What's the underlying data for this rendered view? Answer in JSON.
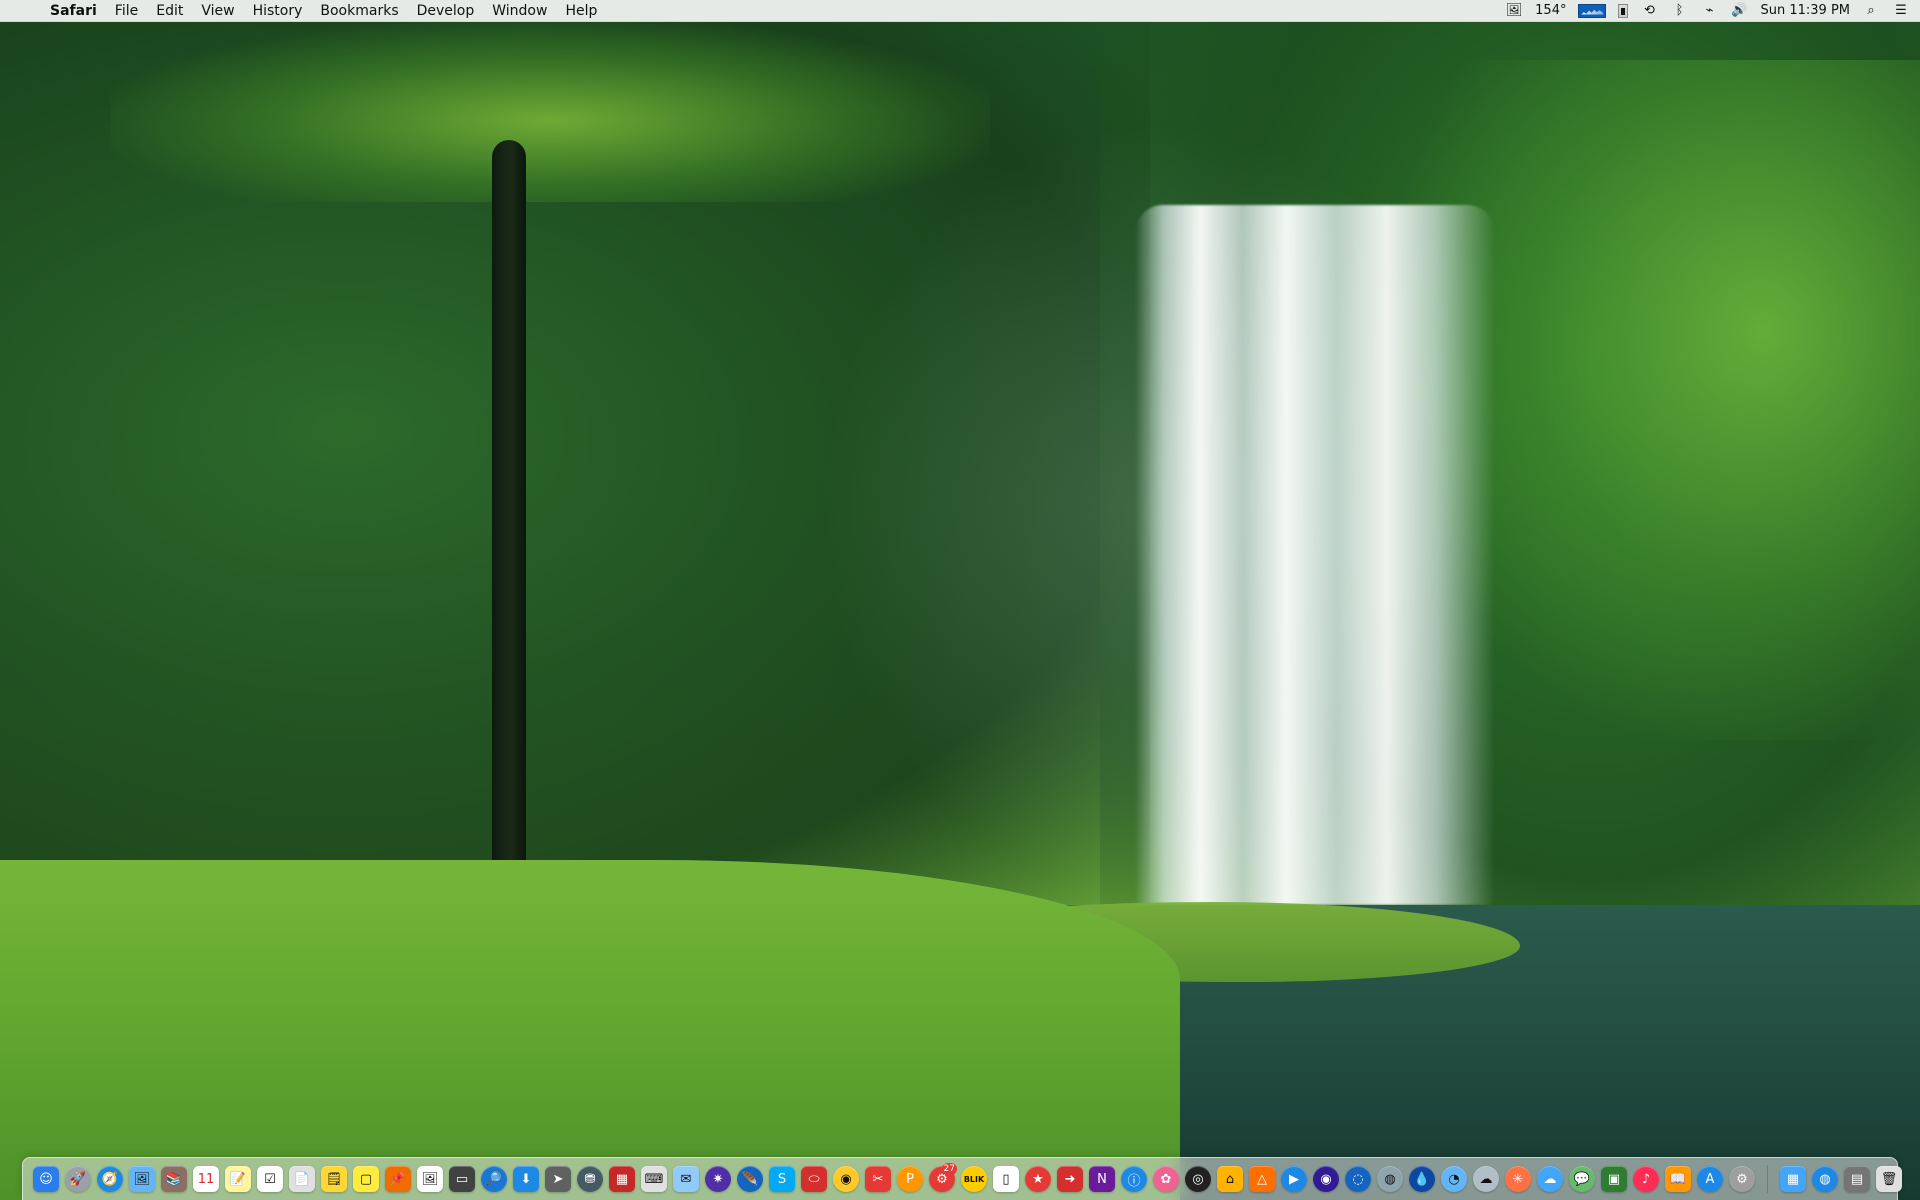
{
  "menubar": {
    "apple_glyph": "",
    "app_name": "Safari",
    "items": [
      "File",
      "Edit",
      "View",
      "History",
      "Bookmarks",
      "Develop",
      "Window",
      "Help"
    ],
    "status": {
      "temperature": "154°",
      "clock": "Sun 11:39 PM",
      "icons": [
        "image-icon",
        "cpu-graph-icon",
        "battery-icon",
        "time-machine-icon",
        "bluetooth-icon",
        "wifi-icon",
        "volume-icon",
        "spotlight-icon",
        "notification-center-icon"
      ]
    }
  },
  "dock": {
    "apps": [
      {
        "name": "finder",
        "glyph": "☺",
        "bg": "#2b7de9",
        "fg": "#ffffff",
        "round": false
      },
      {
        "name": "launchpad",
        "glyph": "🚀",
        "bg": "#9aa0a6",
        "fg": "#ffffff",
        "round": true
      },
      {
        "name": "safari",
        "glyph": "🧭",
        "bg": "#1e88e5",
        "fg": "#ffffff",
        "round": true
      },
      {
        "name": "preview",
        "glyph": "🖼",
        "bg": "#64b5f6",
        "fg": "#111111",
        "round": false
      },
      {
        "name": "bookshelf",
        "glyph": "📚",
        "bg": "#8d6e63",
        "fg": "#ffffff",
        "round": false
      },
      {
        "name": "calendar",
        "glyph": "11",
        "bg": "#ffffff",
        "fg": "#d32f2f",
        "round": false
      },
      {
        "name": "notes",
        "glyph": "📝",
        "bg": "#fff59d",
        "fg": "#111111",
        "round": false
      },
      {
        "name": "reminders",
        "glyph": "☑",
        "bg": "#ffffff",
        "fg": "#111111",
        "round": false
      },
      {
        "name": "documents",
        "glyph": "📄",
        "bg": "#e0e0e0",
        "fg": "#111111",
        "round": false
      },
      {
        "name": "stickies",
        "glyph": "🗒",
        "bg": "#fdd835",
        "fg": "#111111",
        "round": false
      },
      {
        "name": "notes-yellow",
        "glyph": "▢",
        "bg": "#ffeb3b",
        "fg": "#111111",
        "round": false
      },
      {
        "name": "pin-tool",
        "glyph": "📌",
        "bg": "#ef6c00",
        "fg": "#ffffff",
        "round": false
      },
      {
        "name": "image-viewer",
        "glyph": "🖼",
        "bg": "#ffffff",
        "fg": "#111111",
        "round": false
      },
      {
        "name": "screen-app",
        "glyph": "▭",
        "bg": "#424242",
        "fg": "#ffffff",
        "round": false
      },
      {
        "name": "search-app",
        "glyph": "🔎",
        "bg": "#1976d2",
        "fg": "#ffffff",
        "round": true
      },
      {
        "name": "downloads",
        "glyph": "⬇",
        "bg": "#1e88e5",
        "fg": "#ffffff",
        "round": false
      },
      {
        "name": "arrow-app",
        "glyph": "➤",
        "bg": "#616161",
        "fg": "#ffffff",
        "round": false
      },
      {
        "name": "disk-utility",
        "glyph": "⛃",
        "bg": "#455a64",
        "fg": "#ffffff",
        "round": true
      },
      {
        "name": "photo-booth",
        "glyph": "▦",
        "bg": "#c62828",
        "fg": "#ffffff",
        "round": false
      },
      {
        "name": "keyboard-app",
        "glyph": "⌨",
        "bg": "#e0e0e0",
        "fg": "#111111",
        "round": false
      },
      {
        "name": "mail-app",
        "glyph": "✉",
        "bg": "#90caf9",
        "fg": "#111111",
        "round": false
      },
      {
        "name": "galaxy-app",
        "glyph": "✷",
        "bg": "#512da8",
        "fg": "#ffffff",
        "round": true
      },
      {
        "name": "feather-app",
        "glyph": "🪶",
        "bg": "#1565c0",
        "fg": "#ffffff",
        "round": true
      },
      {
        "name": "skype",
        "glyph": "S",
        "bg": "#03a9f4",
        "fg": "#ffffff",
        "round": false
      },
      {
        "name": "red-app",
        "glyph": "⬭",
        "bg": "#d32f2f",
        "fg": "#ffffff",
        "round": false
      },
      {
        "name": "chrome",
        "glyph": "◉",
        "bg": "#ffca28",
        "fg": "#111111",
        "round": true
      },
      {
        "name": "tool-app",
        "glyph": "✂",
        "bg": "#e53935",
        "fg": "#ffffff",
        "round": false
      },
      {
        "name": "p-app",
        "glyph": "P",
        "bg": "#ff9800",
        "fg": "#ffffff",
        "round": true
      },
      {
        "name": "badge-app",
        "glyph": "⚙",
        "bg": "#e53935",
        "fg": "#ffffff",
        "round": true,
        "badge": "27"
      },
      {
        "name": "blik",
        "glyph": "BLIK",
        "bg": "#ffcc00",
        "fg": "#111111",
        "round": true
      },
      {
        "name": "text-editor",
        "glyph": "▯",
        "bg": "#ffffff",
        "fg": "#111111",
        "round": false
      },
      {
        "name": "red-circle",
        "glyph": "★",
        "bg": "#e53935",
        "fg": "#ffffff",
        "round": true
      },
      {
        "name": "arrow-red",
        "glyph": "➜",
        "bg": "#d32f2f",
        "fg": "#ffffff",
        "round": false
      },
      {
        "name": "onenote",
        "glyph": "N",
        "bg": "#6a1b9a",
        "fg": "#ffffff",
        "round": false
      },
      {
        "name": "info-app",
        "glyph": "ⓘ",
        "bg": "#1e88e5",
        "fg": "#ffffff",
        "round": true
      },
      {
        "name": "flower-app",
        "glyph": "✿",
        "bg": "#f06292",
        "fg": "#ffffff",
        "round": true
      },
      {
        "name": "camera-app",
        "glyph": "◎",
        "bg": "#212121",
        "fg": "#ffffff",
        "round": true
      },
      {
        "name": "folder-app",
        "glyph": "⌂",
        "bg": "#ffb300",
        "fg": "#111111",
        "round": false
      },
      {
        "name": "vlc",
        "glyph": "△",
        "bg": "#ff6f00",
        "fg": "#ffffff",
        "round": false
      },
      {
        "name": "play-app",
        "glyph": "▶",
        "bg": "#1e88e5",
        "fg": "#ffffff",
        "round": true
      },
      {
        "name": "record-app",
        "glyph": "◉",
        "bg": "#311b92",
        "fg": "#ffffff",
        "round": true
      },
      {
        "name": "chromium",
        "glyph": "◌",
        "bg": "#1565c0",
        "fg": "#ffffff",
        "round": true
      },
      {
        "name": "globe-app",
        "glyph": "◍",
        "bg": "#90a4ae",
        "fg": "#111111",
        "round": true
      },
      {
        "name": "droplet-app",
        "glyph": "💧",
        "bg": "#0d47a1",
        "fg": "#ffffff",
        "round": true
      },
      {
        "name": "photos-app",
        "glyph": "◔",
        "bg": "#64b5f6",
        "fg": "#111111",
        "round": true
      },
      {
        "name": "weather-app",
        "glyph": "☁",
        "bg": "#b0bec5",
        "fg": "#111111",
        "round": true
      },
      {
        "name": "pinwheel-app",
        "glyph": "✳",
        "bg": "#ff7043",
        "fg": "#ffffff",
        "round": true
      },
      {
        "name": "cloud-app",
        "glyph": "☁",
        "bg": "#42a5f5",
        "fg": "#ffffff",
        "round": true
      },
      {
        "name": "messages",
        "glyph": "💬",
        "bg": "#66bb6a",
        "fg": "#ffffff",
        "round": true
      },
      {
        "name": "facetime",
        "glyph": "▣",
        "bg": "#2e7d32",
        "fg": "#ffffff",
        "round": false
      },
      {
        "name": "music",
        "glyph": "♪",
        "bg": "#ff2d55",
        "fg": "#ffffff",
        "round": true
      },
      {
        "name": "books",
        "glyph": "📖",
        "bg": "#ff9800",
        "fg": "#ffffff",
        "round": false
      },
      {
        "name": "app-store",
        "glyph": "A",
        "bg": "#1e88e5",
        "fg": "#ffffff",
        "round": true
      },
      {
        "name": "settings",
        "glyph": "⚙",
        "bg": "#9e9e9e",
        "fg": "#ffffff",
        "round": true
      }
    ],
    "right": [
      {
        "name": "folder-blue",
        "glyph": "▦",
        "bg": "#42a5f5",
        "fg": "#ffffff",
        "round": false
      },
      {
        "name": "globe-blue",
        "glyph": "◍",
        "bg": "#1e88e5",
        "fg": "#ffffff",
        "round": true
      },
      {
        "name": "stack",
        "glyph": "▤",
        "bg": "#757575",
        "fg": "#ffffff",
        "round": false
      },
      {
        "name": "trash",
        "glyph": "🗑",
        "bg": "#e0e0e0",
        "fg": "#111111",
        "round": false
      }
    ]
  }
}
